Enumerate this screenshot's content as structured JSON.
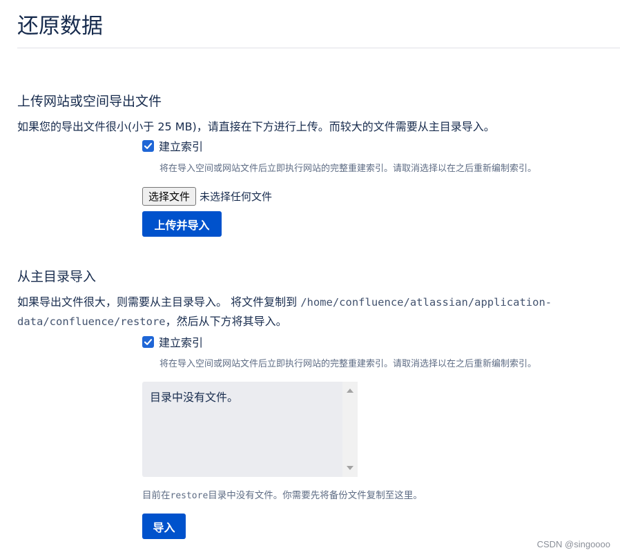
{
  "page": {
    "title": "还原数据"
  },
  "upload_section": {
    "heading": "上传网站或空间导出文件",
    "description": "如果您的导出文件很小(小于 25 MB)，请直接在下方进行上传。而较大的文件需要从主目录导入。",
    "index_checkbox": {
      "label": "建立索引",
      "checked": true,
      "help": "将在导入空间或网站文件后立即执行网站的完整重建索引。请取消选择以在之后重新编制索引。"
    },
    "file_button_label": "选择文件",
    "file_status": "未选择任何文件",
    "submit_label": "上传并导入"
  },
  "home_section": {
    "heading": "从主目录导入",
    "description_prefix": "如果导出文件很大，则需要从主目录导入。 将文件复制到 ",
    "path_line1": "/home/confluence/atlassian/application-",
    "path_line2": "data/confluence/restore",
    "description_suffix": "，然后从下方将其导入。",
    "index_checkbox": {
      "label": "建立索引",
      "checked": true,
      "help": "将在导入空间或网站文件后立即执行网站的完整重建索引。请取消选择以在之后重新编制索引。"
    },
    "file_list_empty": "目录中没有文件。",
    "note_prefix": "目前在",
    "note_code": "restore",
    "note_suffix": "目录中没有文件。你需要先将备份文件复制至这里。",
    "submit_label": "导入"
  },
  "watermark": "CSDN @singoooo",
  "colors": {
    "primary": "#0052cc",
    "checkbox": "#1f66d6",
    "text": "#172b4d",
    "muted": "#5e6c84",
    "listbox_bg": "#ebecf0"
  }
}
